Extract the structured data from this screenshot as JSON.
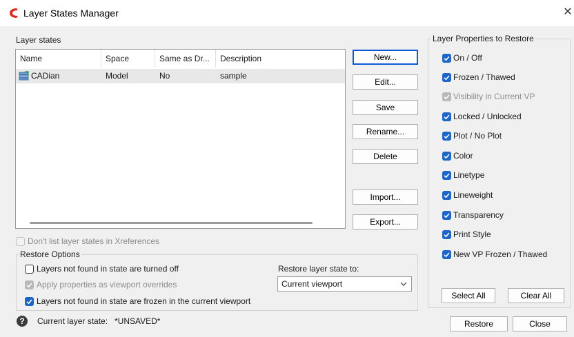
{
  "window": {
    "title": "Layer States Manager",
    "close_glyph": "✕"
  },
  "layer_states": {
    "group_label": "Layer states",
    "columns": [
      "Name",
      "Space",
      "Same as Dr...",
      "Description"
    ],
    "rows": [
      {
        "name": "CADian",
        "space": "Model",
        "same": "No",
        "description": "sample",
        "icon": "layer-state-icon"
      }
    ]
  },
  "buttons": {
    "new": "New...",
    "edit": "Edit...",
    "save": "Save",
    "rename": "Rename...",
    "delete": "Delete",
    "import": "Import...",
    "export": "Export...",
    "select_all": "Select All",
    "clear_all": "Clear All",
    "restore": "Restore",
    "close": "Close"
  },
  "xref_option": {
    "label": "Don't list layer states in Xreferences",
    "checked": false,
    "enabled": false
  },
  "restore_options": {
    "group_label": "Restore Options",
    "items": [
      {
        "label": "Layers not found in state are turned off",
        "checked": false,
        "enabled": true
      },
      {
        "label": "Apply properties as viewport overrides",
        "checked": true,
        "enabled": false
      },
      {
        "label": "Layers not found in state are frozen in the current viewport",
        "checked": true,
        "enabled": true
      }
    ],
    "restore_to_label": "Restore layer state to:",
    "restore_to_value": "Current viewport"
  },
  "properties": {
    "group_label": "Layer Properties to Restore",
    "items": [
      {
        "label": "On / Off",
        "checked": true,
        "enabled": true
      },
      {
        "label": "Frozen / Thawed",
        "checked": true,
        "enabled": true
      },
      {
        "label": "Visibility in Current VP",
        "checked": true,
        "enabled": false
      },
      {
        "label": "Locked / Unlocked",
        "checked": true,
        "enabled": true
      },
      {
        "label": "Plot / No Plot",
        "checked": true,
        "enabled": true
      },
      {
        "label": "Color",
        "checked": true,
        "enabled": true
      },
      {
        "label": "Linetype",
        "checked": true,
        "enabled": true
      },
      {
        "label": "Lineweight",
        "checked": true,
        "enabled": true
      },
      {
        "label": "Transparency",
        "checked": true,
        "enabled": true
      },
      {
        "label": "Print Style",
        "checked": true,
        "enabled": true
      },
      {
        "label": "New VP Frozen / Thawed",
        "checked": true,
        "enabled": true
      }
    ]
  },
  "status": {
    "label": "Current layer state:",
    "value": "*UNSAVED*",
    "help_glyph": "?"
  },
  "colors": {
    "accent": "#1d66c7",
    "app_logo": "#d92b1c"
  }
}
